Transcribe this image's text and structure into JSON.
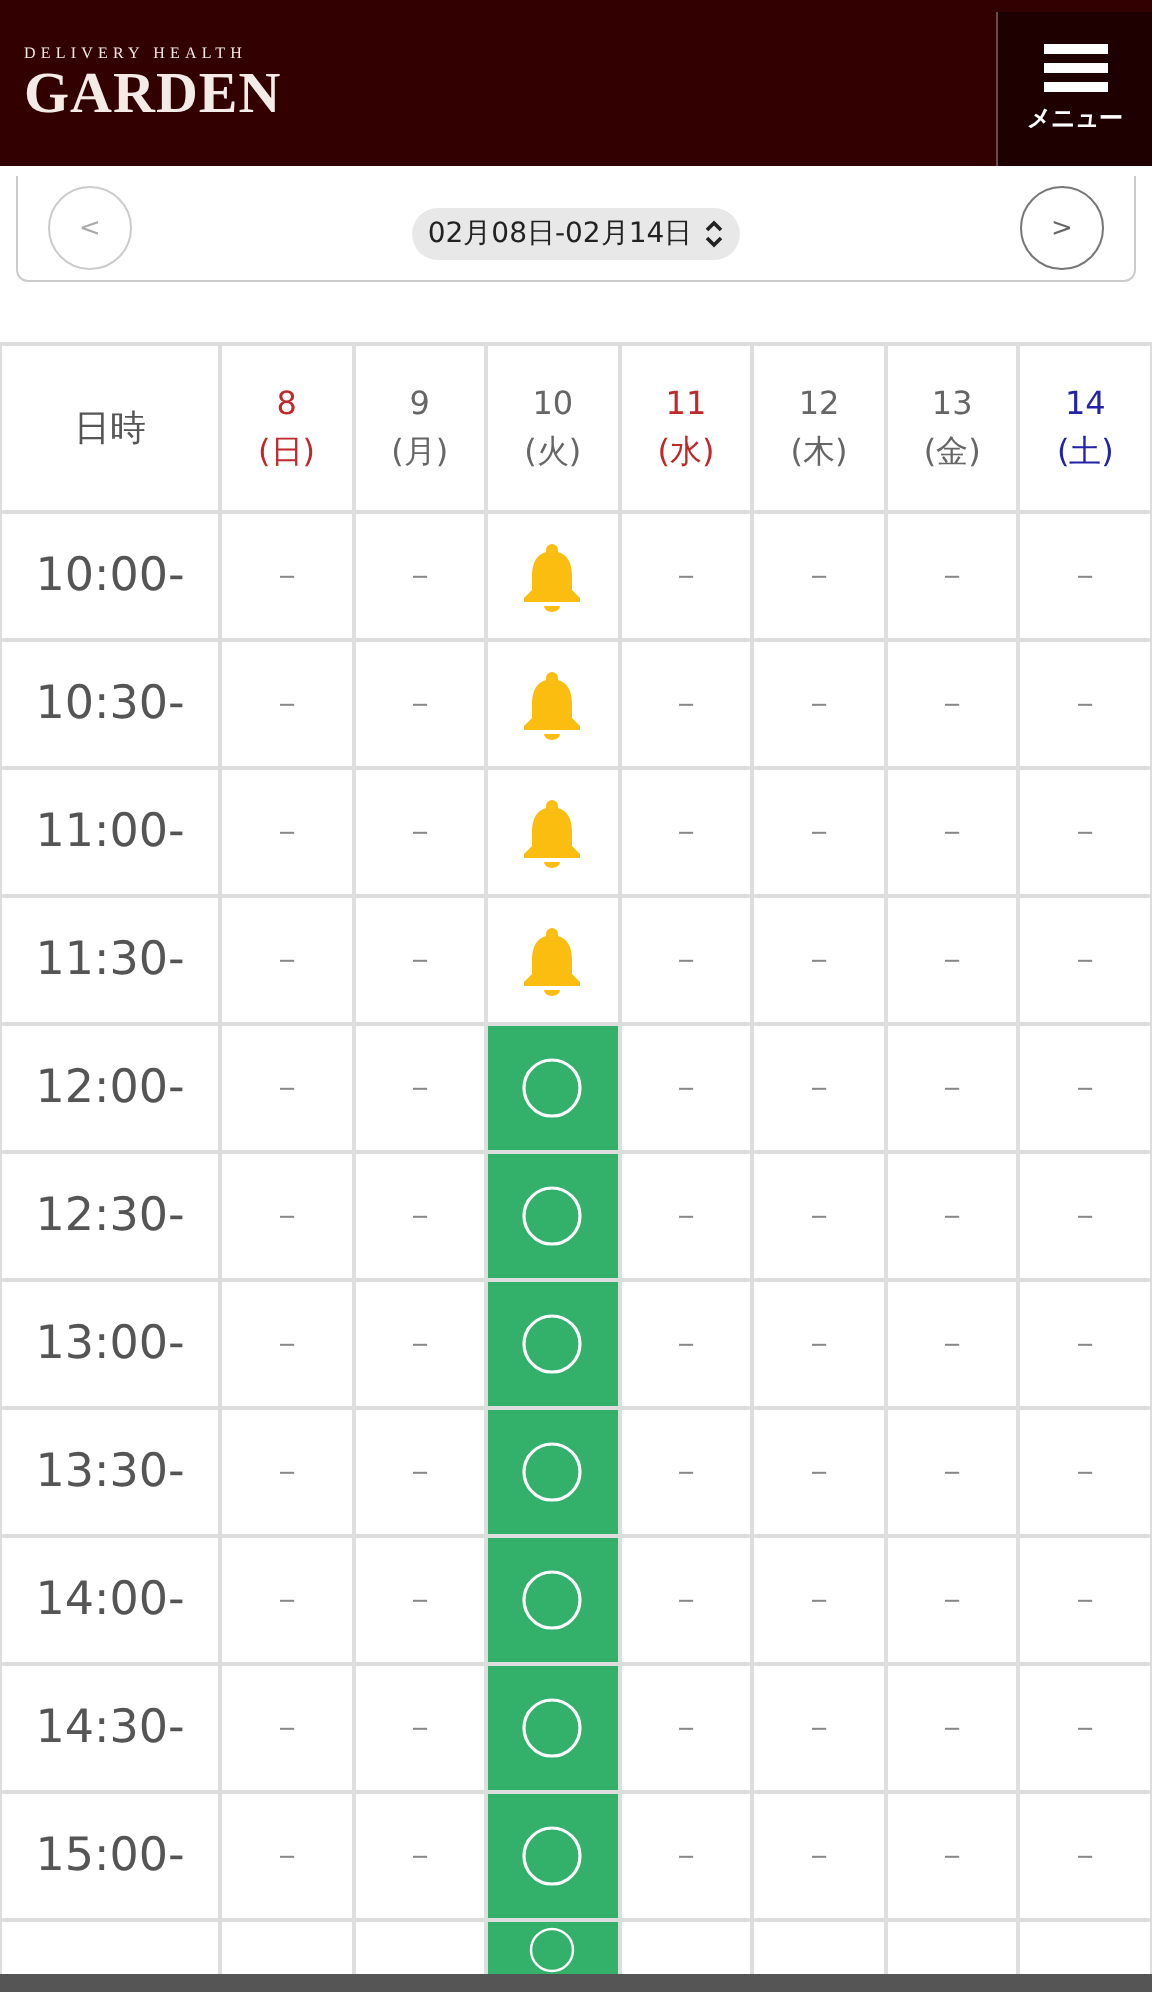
{
  "header": {
    "logo_tagline": "DELIVERY HEALTH",
    "logo": "GARDEN",
    "menu_label": "メニュー"
  },
  "date_nav": {
    "prev": "<",
    "range": "02月08日-02月14日",
    "next": ">"
  },
  "table": {
    "corner": "日時",
    "days": [
      {
        "date": "8",
        "weekday": "(日)",
        "color": "#c0292b"
      },
      {
        "date": "9",
        "weekday": "(月)",
        "color": "#666666"
      },
      {
        "date": "10",
        "weekday": "(火)",
        "color": "#666666"
      },
      {
        "date": "11",
        "weekday": "(水)",
        "color": "#c0292b"
      },
      {
        "date": "12",
        "weekday": "(木)",
        "color": "#666666"
      },
      {
        "date": "13",
        "weekday": "(金)",
        "color": "#666666"
      },
      {
        "date": "14",
        "weekday": "(土)",
        "color": "#2323a8"
      }
    ],
    "rows": [
      {
        "time": "10:00-",
        "cells": [
          {
            "kind": "none",
            "text": "－"
          },
          {
            "kind": "none",
            "text": "－"
          },
          {
            "kind": "call"
          },
          {
            "kind": "none",
            "text": "－"
          },
          {
            "kind": "none",
            "text": "－"
          },
          {
            "kind": "none",
            "text": "－"
          },
          {
            "kind": "none",
            "text": "－"
          }
        ]
      },
      {
        "time": "10:30-",
        "cells": [
          {
            "kind": "none",
            "text": "－"
          },
          {
            "kind": "none",
            "text": "－"
          },
          {
            "kind": "call"
          },
          {
            "kind": "none",
            "text": "－"
          },
          {
            "kind": "none",
            "text": "－"
          },
          {
            "kind": "none",
            "text": "－"
          },
          {
            "kind": "none",
            "text": "－"
          }
        ]
      },
      {
        "time": "11:00-",
        "cells": [
          {
            "kind": "none",
            "text": "－"
          },
          {
            "kind": "none",
            "text": "－"
          },
          {
            "kind": "call"
          },
          {
            "kind": "none",
            "text": "－"
          },
          {
            "kind": "none",
            "text": "－"
          },
          {
            "kind": "none",
            "text": "－"
          },
          {
            "kind": "none",
            "text": "－"
          }
        ]
      },
      {
        "time": "11:30-",
        "cells": [
          {
            "kind": "none",
            "text": "－"
          },
          {
            "kind": "none",
            "text": "－"
          },
          {
            "kind": "call"
          },
          {
            "kind": "none",
            "text": "－"
          },
          {
            "kind": "none",
            "text": "－"
          },
          {
            "kind": "none",
            "text": "－"
          },
          {
            "kind": "none",
            "text": "－"
          }
        ]
      },
      {
        "time": "12:00-",
        "cells": [
          {
            "kind": "none",
            "text": "－"
          },
          {
            "kind": "none",
            "text": "－"
          },
          {
            "kind": "open"
          },
          {
            "kind": "none",
            "text": "－"
          },
          {
            "kind": "none",
            "text": "－"
          },
          {
            "kind": "none",
            "text": "－"
          },
          {
            "kind": "none",
            "text": "－"
          }
        ]
      },
      {
        "time": "12:30-",
        "cells": [
          {
            "kind": "none",
            "text": "－"
          },
          {
            "kind": "none",
            "text": "－"
          },
          {
            "kind": "open"
          },
          {
            "kind": "none",
            "text": "－"
          },
          {
            "kind": "none",
            "text": "－"
          },
          {
            "kind": "none",
            "text": "－"
          },
          {
            "kind": "none",
            "text": "－"
          }
        ]
      },
      {
        "time": "13:00-",
        "cells": [
          {
            "kind": "none",
            "text": "－"
          },
          {
            "kind": "none",
            "text": "－"
          },
          {
            "kind": "open"
          },
          {
            "kind": "none",
            "text": "－"
          },
          {
            "kind": "none",
            "text": "－"
          },
          {
            "kind": "none",
            "text": "－"
          },
          {
            "kind": "none",
            "text": "－"
          }
        ]
      },
      {
        "time": "13:30-",
        "cells": [
          {
            "kind": "none",
            "text": "－"
          },
          {
            "kind": "none",
            "text": "－"
          },
          {
            "kind": "open"
          },
          {
            "kind": "none",
            "text": "－"
          },
          {
            "kind": "none",
            "text": "－"
          },
          {
            "kind": "none",
            "text": "－"
          },
          {
            "kind": "none",
            "text": "－"
          }
        ]
      },
      {
        "time": "14:00-",
        "cells": [
          {
            "kind": "none",
            "text": "－"
          },
          {
            "kind": "none",
            "text": "－"
          },
          {
            "kind": "open"
          },
          {
            "kind": "none",
            "text": "－"
          },
          {
            "kind": "none",
            "text": "－"
          },
          {
            "kind": "none",
            "text": "－"
          },
          {
            "kind": "none",
            "text": "－"
          }
        ]
      },
      {
        "time": "14:30-",
        "cells": [
          {
            "kind": "none",
            "text": "－"
          },
          {
            "kind": "none",
            "text": "－"
          },
          {
            "kind": "open"
          },
          {
            "kind": "none",
            "text": "－"
          },
          {
            "kind": "none",
            "text": "－"
          },
          {
            "kind": "none",
            "text": "－"
          },
          {
            "kind": "none",
            "text": "－"
          }
        ]
      },
      {
        "time": "15:00-",
        "cells": [
          {
            "kind": "none",
            "text": "－"
          },
          {
            "kind": "none",
            "text": "－"
          },
          {
            "kind": "open"
          },
          {
            "kind": "none",
            "text": "－"
          },
          {
            "kind": "none",
            "text": "－"
          },
          {
            "kind": "none",
            "text": "－"
          },
          {
            "kind": "none",
            "text": "－"
          }
        ]
      },
      {
        "cells": [
          {
            "kind": "empty"
          },
          {
            "kind": "empty"
          },
          {
            "kind": "open"
          },
          {
            "kind": "empty"
          },
          {
            "kind": "empty"
          },
          {
            "kind": "empty"
          },
          {
            "kind": "empty"
          }
        ]
      }
    ]
  }
}
